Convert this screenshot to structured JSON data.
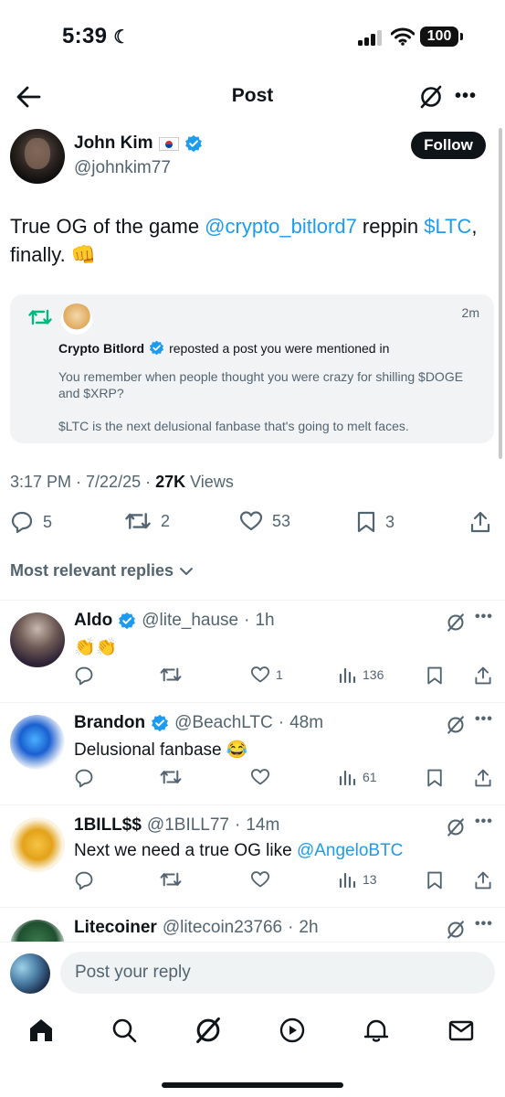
{
  "status": {
    "time": "5:39",
    "battery": "100"
  },
  "header": {
    "title": "Post"
  },
  "post": {
    "author": "John Kim",
    "flag": "🇰🇷",
    "handle": "@johnkim77",
    "follow_label": "Follow",
    "text_1": "True OG of the game ",
    "mention": "@crypto_bitlord7",
    "text_2": " reppin ",
    "cashtag": "$LTC",
    "text_3": ",",
    "text_4": "finally. 👊",
    "timestamp": "3:17 PM · 7/22/25 · ",
    "views_count": "27K",
    "views_label": " Views",
    "stats": {
      "replies": "5",
      "reposts": "2",
      "likes": "53",
      "bookmarks": "3"
    }
  },
  "quote": {
    "time": "2m",
    "name": "Crypto Bitlord",
    "action": "reposted a post you were mentioned in",
    "body_1": "You remember when people thought you were crazy for shilling $DOGE and $XRP?",
    "body_2": "$LTC is the next delusional fanbase that's going to melt faces."
  },
  "sort_label": "Most relevant replies",
  "replies": [
    {
      "name": "Aldo",
      "handle": "@lite_hause",
      "time": "1h",
      "text": "👏👏",
      "likes": "1",
      "views": "136"
    },
    {
      "name": "Brandon",
      "handle": "@BeachLTC",
      "time": "48m",
      "text": "Delusional fanbase 😂",
      "likes": "",
      "views": "61"
    },
    {
      "name": "1BILL$$",
      "handle": "@1BILL77",
      "time": "14m",
      "text": "Next we need a true OG like ",
      "mention": "@AngeloBTC",
      "likes": "",
      "views": "13"
    },
    {
      "name": "Litecoiner",
      "handle": "@litecoin23766",
      "time": "2h"
    }
  ],
  "composer": {
    "placeholder": "Post your reply"
  },
  "colors": {
    "accent": "#1d9bf0",
    "repost_green": "#00ba7c",
    "text_secondary": "#536471"
  },
  "icons": [
    "back-arrow-icon",
    "grok-icon",
    "more-icon",
    "verified-icon",
    "repost-icon",
    "reply-icon",
    "like-icon",
    "bookmark-icon",
    "share-icon",
    "views-icon",
    "chevron-down-icon",
    "home-icon",
    "search-icon",
    "play-icon",
    "bell-icon",
    "mail-icon"
  ]
}
